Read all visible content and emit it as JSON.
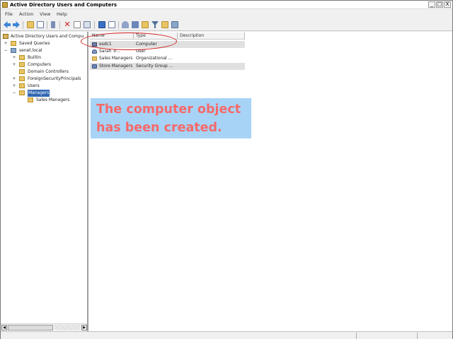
{
  "window": {
    "title": "Active Directory Users and Computers",
    "controls": {
      "minimize": "_",
      "maximize": "□",
      "close": "X"
    }
  },
  "menu": [
    "File",
    "Action",
    "View",
    "Help"
  ],
  "toolbar": {
    "buttons": [
      "back-icon",
      "forward-icon",
      "up-folder-icon",
      "show-hide-tree-icon",
      "properties-icon",
      "delete-icon",
      "copy-icon",
      "export-icon",
      "help-icon",
      "refresh-icon",
      "new-user-icon",
      "new-group-icon",
      "new-ou-icon",
      "filter-icon",
      "find-icon",
      "add-to-group-icon"
    ]
  },
  "tree": {
    "root": "Active Directory Users and Compu",
    "saved_queries": "Saved Queries",
    "domain": "senet.local",
    "children": [
      "Builtin",
      "Computers",
      "Domain Controllers",
      "ForeignSecurityPrincipals",
      "Users",
      "Managers"
    ],
    "selected": "Managers",
    "sub_children": [
      "Sales Managers"
    ]
  },
  "list": {
    "columns": [
      "Name",
      "Type",
      "Description"
    ],
    "rows": [
      {
        "name": "esdc1",
        "type": "Computer",
        "description": ""
      },
      {
        "name": "Sarah Tr...",
        "type": "User",
        "description": ""
      },
      {
        "name": "Sales Managers",
        "type": "Organizational ...",
        "description": ""
      },
      {
        "name": "Store Managers",
        "type": "Security Group ...",
        "description": ""
      }
    ]
  },
  "callout": {
    "line1": "The computer object",
    "line2": "has been created."
  },
  "colors": {
    "callout_bg": "#a7d3f7",
    "callout_text": "#f56a6a",
    "highlight_oval": "#d31a1a",
    "selection": "#3167b2"
  }
}
